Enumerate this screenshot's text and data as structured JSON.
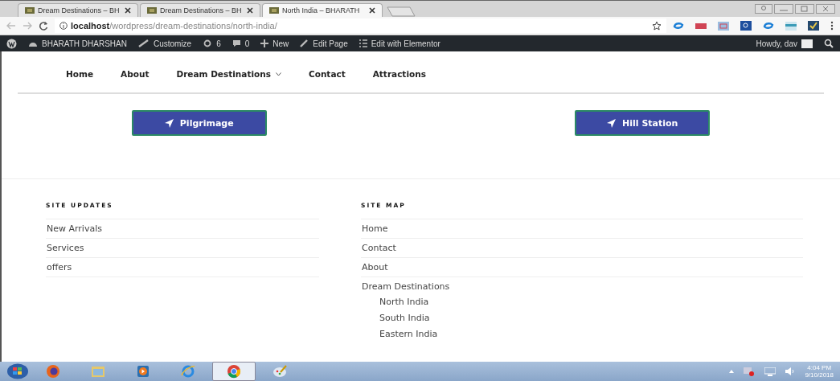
{
  "browser": {
    "tabs": [
      {
        "title": "Dream Destinations – BH",
        "selected": false
      },
      {
        "title": "Dream Destinations – BH",
        "selected": false
      },
      {
        "title": "North India – BHARATH",
        "selected": true
      }
    ],
    "address": "**localhost**/wordpress/dream-destinations/north-india/"
  },
  "admin_bar": {
    "site": "BHARATH DHARSHAN",
    "customize": "Customize",
    "updates": "6",
    "comments": "0",
    "new": "New",
    "edit_page": "Edit Page",
    "edit_elementor": "Edit with Elementor",
    "greeting": "Howdy, dav"
  },
  "nav": [
    {
      "label": "Home",
      "dropdown": false
    },
    {
      "label": "About",
      "dropdown": false
    },
    {
      "label": "Dream Destinations",
      "dropdown": true
    },
    {
      "label": "Contact",
      "dropdown": false
    },
    {
      "label": "Attractions",
      "dropdown": false
    }
  ],
  "buttons": [
    "Pilgrimage",
    "Hill Station"
  ],
  "footer": [
    {
      "heading": "SITE UPDATES",
      "items": [
        {
          "label": "New Arrivals"
        },
        {
          "label": "Services"
        },
        {
          "label": "offers"
        }
      ]
    },
    {
      "heading": "SITE MAP",
      "items": [
        {
          "label": "Home"
        },
        {
          "label": "Contact"
        },
        {
          "label": "About"
        },
        {
          "label": "Dream Destinations",
          "children": [
            {
              "label": "North India"
            },
            {
              "label": "South India"
            },
            {
              "label": "Eastern India"
            }
          ]
        }
      ]
    }
  ],
  "taskbar": {
    "apps": [
      {
        "kind": "firefox",
        "selected": false
      },
      {
        "kind": "folder",
        "selected": false
      },
      {
        "kind": "media",
        "selected": false
      },
      {
        "kind": "ie",
        "selected": false
      },
      {
        "kind": "chrome",
        "selected": true
      },
      {
        "kind": "paint",
        "selected": false
      }
    ],
    "time": "4:04 PM",
    "date": "9/10/2018"
  }
}
